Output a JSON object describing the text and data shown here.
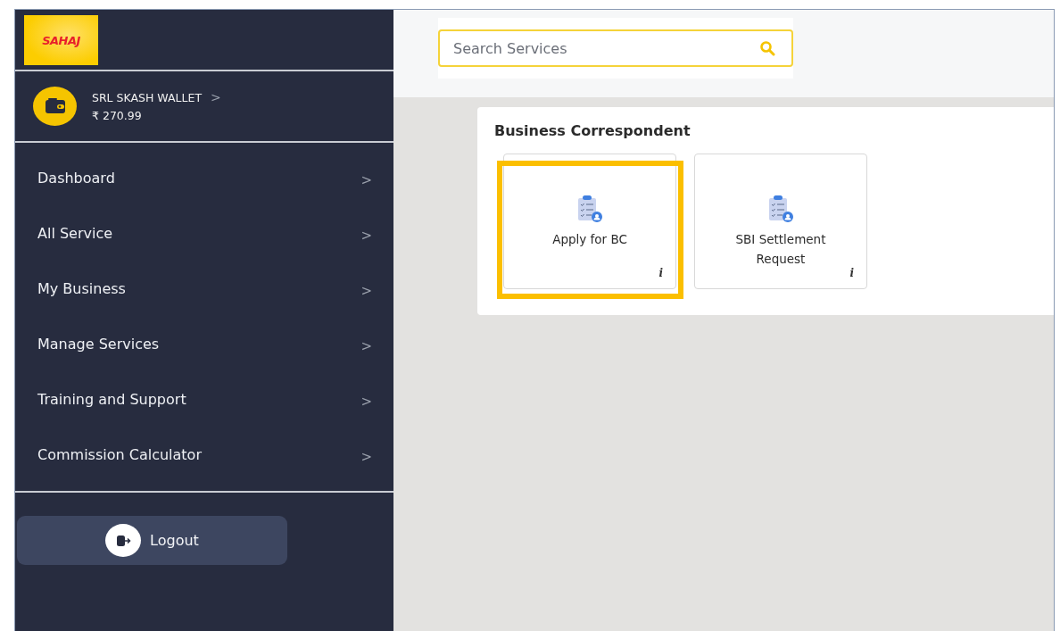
{
  "sidebar": {
    "logo": "SAHAJ",
    "wallet": {
      "name": "SRL SKASH WALLET",
      "chevron": ">",
      "balance": "₹ 270.99"
    },
    "items": [
      {
        "label": "Dashboard",
        "chevron": ">"
      },
      {
        "label": "All Service",
        "chevron": ">"
      },
      {
        "label": "My Business",
        "chevron": ">"
      },
      {
        "label": "Manage Services",
        "chevron": ">"
      },
      {
        "label": "Training and Support",
        "chevron": ">"
      },
      {
        "label": "Commission Calculator",
        "chevron": ">"
      }
    ],
    "logout": "Logout"
  },
  "search": {
    "placeholder": "Search Services"
  },
  "section": {
    "title": "Business Correspondent",
    "tiles": [
      {
        "label": "Apply for BC",
        "info": "i",
        "highlighted": true
      },
      {
        "label": "SBI Settlement Request",
        "info": "i",
        "highlighted": false
      }
    ]
  }
}
